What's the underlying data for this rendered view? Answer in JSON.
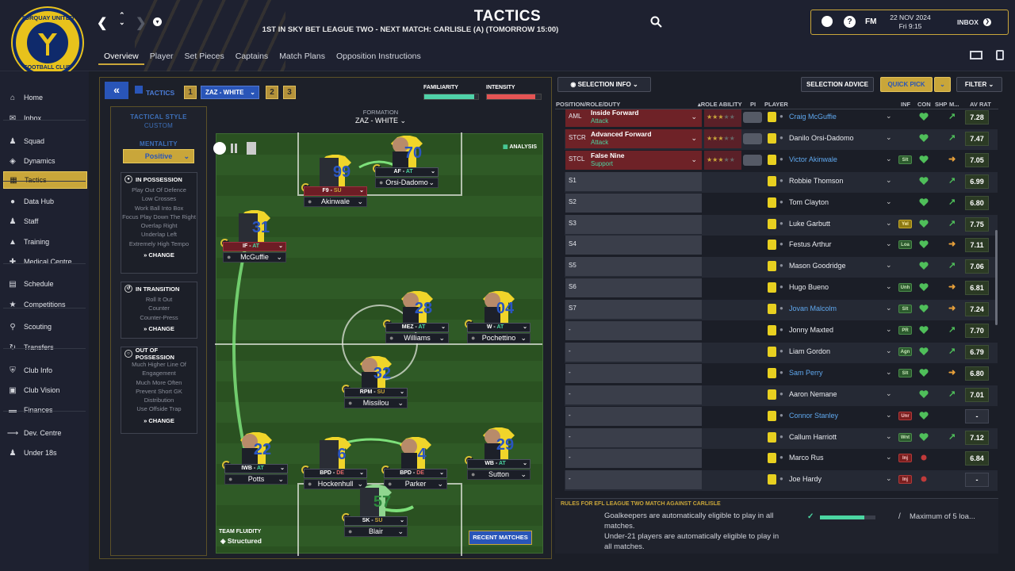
{
  "app": {
    "title": "TACTICS",
    "subtitle": "1ST IN SKY BET LEAGUE TWO - NEXT MATCH: CARLISLE (A) (TOMORROW 15:00)",
    "club_crest_top": "TORQUAY UNITED",
    "club_crest_bottom": "FOOTBALL CLUB",
    "fm": "FM",
    "date": "22 NOV 2024",
    "time": "Fri 9:15",
    "inbox": "INBOX"
  },
  "subnav": [
    "Overview",
    "Player",
    "Set Pieces",
    "Captains",
    "Match Plans",
    "Opposition Instructions"
  ],
  "subnav_active": "Overview",
  "sidebar": [
    {
      "label": "Home",
      "icon": "home-icon"
    },
    {
      "label": "Inbox",
      "icon": "inbox-icon"
    },
    {
      "label": "Squad",
      "icon": "squad-icon"
    },
    {
      "label": "Dynamics",
      "icon": "dynamics-icon"
    },
    {
      "label": "Tactics",
      "icon": "tactics-icon"
    },
    {
      "label": "Data Hub",
      "icon": "data-hub-icon"
    },
    {
      "label": "Staff",
      "icon": "staff-icon"
    },
    {
      "label": "Training",
      "icon": "training-icon"
    },
    {
      "label": "Medical Centre",
      "icon": "medical-icon"
    },
    {
      "label": "Schedule",
      "icon": "schedule-icon"
    },
    {
      "label": "Competitions",
      "icon": "trophy-icon"
    },
    {
      "label": "Scouting",
      "icon": "scouting-icon"
    },
    {
      "label": "Transfers",
      "icon": "transfers-icon"
    },
    {
      "label": "Club Info",
      "icon": "club-info-icon"
    },
    {
      "label": "Club Vision",
      "icon": "club-vision-icon"
    },
    {
      "label": "Finances",
      "icon": "finances-icon"
    },
    {
      "label": "Dev. Centre",
      "icon": "dev-centre-icon"
    },
    {
      "label": "Under 18s",
      "icon": "under18-icon"
    }
  ],
  "tactics": {
    "tab_label": "TACTICS",
    "slot1": "1",
    "tactic_name": "ZAZ - WHITE",
    "slot2": "2",
    "slot3": "3",
    "familiarity_label": "FAMILIARITY",
    "familiarity_level": 0.93,
    "intensity_label": "INTENSITY",
    "intensity_level": 0.9,
    "formation_label": "FORMATION",
    "formation_name": "ZAZ - WHITE",
    "analysis": "ANALYSIS",
    "team_fluidity_label": "TEAM FLUIDITY",
    "team_fluidity": "Structured",
    "recent_matches": "RECENT MATCHES"
  },
  "style": {
    "tactical_style_label": "TACTICAL STYLE",
    "tactical_style": "CUSTOM",
    "mentality_label": "MENTALITY",
    "mentality": "Positive",
    "in_possession": {
      "title": "IN POSSESSION",
      "items": [
        "Play Out Of Defence",
        "Low Crosses",
        "Work Ball Into Box",
        "Focus Play Down The Right",
        "Overlap Right",
        "Underlap Left",
        "Extremely High Tempo"
      ],
      "change": "CHANGE"
    },
    "in_transition": {
      "title": "IN TRANSITION",
      "items": [
        "Roll It Out",
        "Counter",
        "Counter-Press"
      ],
      "change": "CHANGE"
    },
    "out_of_possession": {
      "title": "OUT OF POSSESSION",
      "items": [
        "Much Higher Line Of Engagement",
        "Much More Often",
        "Prevent Short GK Distribution",
        "Use Offside Trap"
      ],
      "change": "CHANGE"
    }
  },
  "pitch_players": [
    {
      "name": "Orsi-Dadomo",
      "role": "AF",
      "duty": "AT",
      "number": "70",
      "photo": true,
      "red": false
    },
    {
      "name": "Akinwale",
      "role": "F9",
      "duty": "SU",
      "number": "99",
      "photo": false,
      "red": true
    },
    {
      "name": "McGuffie",
      "role": "IF",
      "duty": "AT",
      "number": "31",
      "photo": false,
      "red": true
    },
    {
      "name": "Williams",
      "role": "MEZ",
      "duty": "AT",
      "number": "28",
      "photo": true,
      "red": false
    },
    {
      "name": "Pochettino",
      "role": "W",
      "duty": "AT",
      "number": "04",
      "photo": true,
      "red": false
    },
    {
      "name": "Missilou",
      "role": "RPM",
      "duty": "SU",
      "number": "32",
      "photo": true,
      "red": false
    },
    {
      "name": "Potts",
      "role": "IWB",
      "duty": "AT",
      "number": "22",
      "photo": true,
      "red": false
    },
    {
      "name": "Hockenhull",
      "role": "BPD",
      "duty": "DE",
      "number": "6",
      "photo": false,
      "red": false
    },
    {
      "name": "Parker",
      "role": "BPD",
      "duty": "DE",
      "number": "4",
      "photo": true,
      "red": false
    },
    {
      "name": "Sutton",
      "role": "WB",
      "duty": "AT",
      "number": "29",
      "photo": true,
      "red": false
    },
    {
      "name": "Blair",
      "role": "SK",
      "duty": "SU",
      "number": "57",
      "photo": false,
      "red": false
    }
  ],
  "selection": {
    "info": "SELECTION INFO",
    "advice": "SELECTION ADVICE",
    "quick_pick": "QUICK PICK",
    "filter": "FILTER",
    "columns": {
      "position": "POSITION/ROLE/DUTY",
      "ability": "ROLE ABILITY",
      "pi": "PI",
      "player": "PLAYER",
      "inf": "INF",
      "con": "CON",
      "shp": "SHP",
      "m": "M...",
      "av": "AV RAT"
    },
    "positions": [
      {
        "code": "AML",
        "role": "Inside Forward",
        "duty": "Attack",
        "red": true
      },
      {
        "code": "STCR",
        "role": "Advanced Forward",
        "duty": "Attack",
        "red": true
      },
      {
        "code": "STCL",
        "role": "False Nine",
        "duty": "Support",
        "red": true
      },
      {
        "code": "S1",
        "role": "",
        "duty": "",
        "red": false
      },
      {
        "code": "S2",
        "role": "",
        "duty": "",
        "red": false
      },
      {
        "code": "S3",
        "role": "",
        "duty": "",
        "red": false
      },
      {
        "code": "S4",
        "role": "",
        "duty": "",
        "red": false
      },
      {
        "code": "S5",
        "role": "",
        "duty": "",
        "red": false
      },
      {
        "code": "S6",
        "role": "",
        "duty": "",
        "red": false
      },
      {
        "code": "S7",
        "role": "",
        "duty": "",
        "red": false
      },
      {
        "code": "-",
        "role": "",
        "duty": "",
        "red": false
      },
      {
        "code": "-",
        "role": "",
        "duty": "",
        "red": false
      },
      {
        "code": "-",
        "role": "",
        "duty": "",
        "red": false
      },
      {
        "code": "-",
        "role": "",
        "duty": "",
        "red": false
      },
      {
        "code": "-",
        "role": "",
        "duty": "",
        "red": false
      },
      {
        "code": "-",
        "role": "",
        "duty": "",
        "red": false
      },
      {
        "code": "-",
        "role": "",
        "duty": "",
        "red": false
      },
      {
        "code": "-",
        "role": "",
        "duty": "",
        "red": false
      }
    ],
    "players": [
      {
        "name": "Craig McGuffie",
        "blue": true,
        "inf": "",
        "infc": "",
        "con": "green",
        "shp": "up",
        "rat": "7.28"
      },
      {
        "name": "Danilo Orsi-Dadomo",
        "blue": false,
        "inf": "",
        "infc": "",
        "con": "green",
        "shp": "up",
        "rat": "7.47"
      },
      {
        "name": "Victor Akinwale",
        "blue": true,
        "inf": "Slt",
        "infc": "g",
        "con": "green",
        "shp": "right",
        "rat": "7.05"
      },
      {
        "name": "Robbie Thomson",
        "blue": false,
        "inf": "",
        "infc": "",
        "con": "green",
        "shp": "up",
        "rat": "6.99"
      },
      {
        "name": "Tom Clayton",
        "blue": false,
        "inf": "",
        "infc": "",
        "con": "green",
        "shp": "up",
        "rat": "6.80"
      },
      {
        "name": "Luke Garbutt",
        "blue": false,
        "inf": "Yel",
        "infc": "y",
        "con": "green",
        "shp": "up",
        "rat": "7.75"
      },
      {
        "name": "Festus Arthur",
        "blue": false,
        "inf": "Loa",
        "infc": "g",
        "con": "green",
        "shp": "right",
        "rat": "7.11"
      },
      {
        "name": "Mason Goodridge",
        "blue": false,
        "inf": "",
        "infc": "",
        "con": "green",
        "shp": "up",
        "rat": "7.06"
      },
      {
        "name": "Hugo Bueno",
        "blue": false,
        "inf": "Unh",
        "infc": "g",
        "con": "green",
        "shp": "right",
        "rat": "6.81"
      },
      {
        "name": "Jovan Malcolm",
        "blue": true,
        "inf": "Slt",
        "infc": "g",
        "con": "green",
        "shp": "right",
        "rat": "7.24"
      },
      {
        "name": "Jonny Maxted",
        "blue": false,
        "inf": "PR",
        "infc": "g",
        "con": "green",
        "shp": "up",
        "rat": "7.70"
      },
      {
        "name": "Liam Gordon",
        "blue": false,
        "inf": "Agn",
        "infc": "g",
        "con": "green",
        "shp": "up",
        "rat": "6.79"
      },
      {
        "name": "Sam Perry",
        "blue": true,
        "inf": "Slt",
        "infc": "g",
        "con": "green",
        "shp": "right",
        "rat": "6.80"
      },
      {
        "name": "Aaron Nemane",
        "blue": false,
        "inf": "",
        "infc": "",
        "con": "green",
        "shp": "up",
        "rat": "7.01"
      },
      {
        "name": "Connor Stanley",
        "blue": true,
        "inf": "Unr",
        "infc": "r",
        "con": "green",
        "shp": "",
        "rat": "-"
      },
      {
        "name": "Callum Harriott",
        "blue": false,
        "inf": "Wnt",
        "infc": "g",
        "con": "green",
        "shp": "up",
        "rat": "7.12"
      },
      {
        "name": "Marco Rus",
        "blue": false,
        "inf": "Inj",
        "infc": "r",
        "con": "red",
        "shp": "",
        "rat": "6.84"
      },
      {
        "name": "Joe Hardy",
        "blue": false,
        "inf": "Inj",
        "infc": "r",
        "con": "red",
        "shp": "",
        "rat": "-"
      }
    ],
    "rules_title": "RULES FOR EFL LEAGUE TWO MATCH AGAINST CARLISLE",
    "rule1": "Goalkeepers are automatically eligible to play in all matches.",
    "rule2": "Under-21 players are automatically eligible to play in all matches.",
    "rule_max": "Maximum of 5 loa...",
    "slash": "/"
  }
}
